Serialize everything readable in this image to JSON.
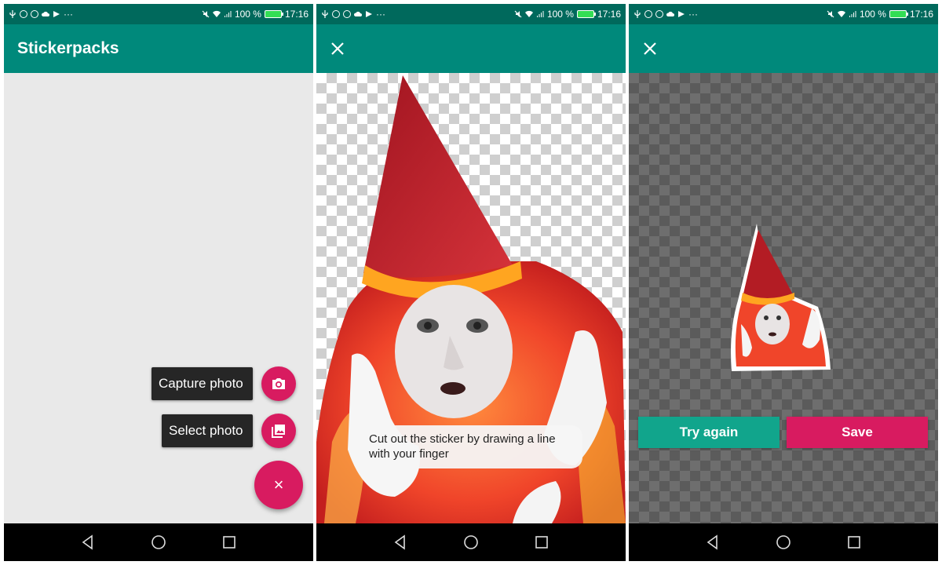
{
  "status_bar": {
    "left_icons": [
      "usb-icon",
      "b-circle-icon",
      "chrome-icon",
      "cloud-icon",
      "flag-icon",
      "more-dots-icon"
    ],
    "more": "···",
    "right_icons": [
      "mute-icon",
      "wifi-icon",
      "signal-icon",
      "battery-icon"
    ],
    "battery_percent": "100 %",
    "time": "17:16"
  },
  "screen1": {
    "title": "Stickerpacks",
    "fab_menu": {
      "capture_label": "Capture photo",
      "select_label": "Select photo",
      "close_symbol": "×"
    }
  },
  "screen2": {
    "hint": "Cut out the sticker by drawing a line with your finger"
  },
  "screen3": {
    "try_again_label": "Try again",
    "save_label": "Save"
  },
  "colors": {
    "status_bar": "#00695c",
    "app_bar": "#00897b",
    "accent_pink": "#d81b60",
    "teal_button": "#11a58c",
    "nav_bar": "#000000"
  }
}
